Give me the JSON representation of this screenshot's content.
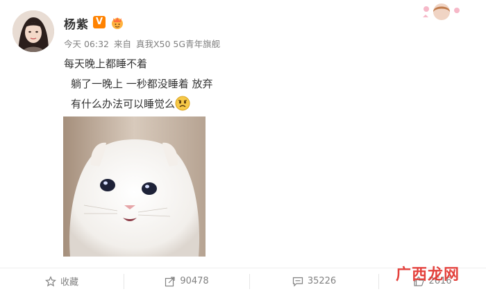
{
  "post": {
    "username": "杨紫",
    "vip_badge": "V",
    "time": "今天 06:32",
    "source_prefix": "来自",
    "source_device": "真我X50 5G青年旗舰",
    "lines": [
      "每天晚上都睡不着",
      "躺了一晚上 一秒都没睡着 放弃",
      "有什么办法可以睡觉么"
    ],
    "emoji": "sad-face-icon"
  },
  "actions": {
    "favorite_label": "收藏",
    "share_count": "90478",
    "comment_count": "35226",
    "like_count": "2616"
  },
  "watermark": {
    "text": "广西龙网"
  },
  "colors": {
    "vip": "#ff8200",
    "meta": "#808080",
    "text": "#333333",
    "watermark": "#e2322d"
  }
}
